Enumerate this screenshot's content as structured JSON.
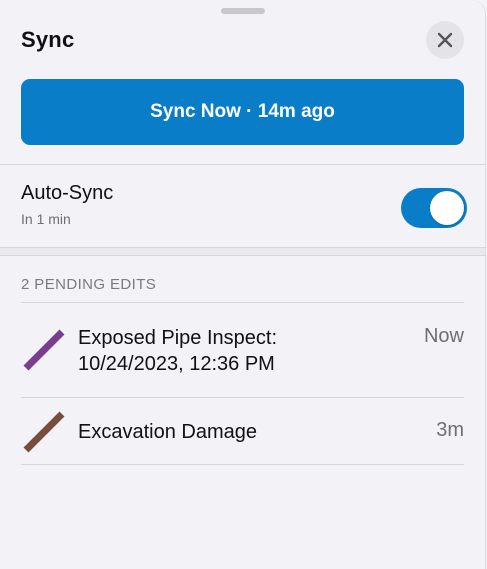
{
  "sheet": {
    "title": "Sync",
    "close_icon": "close-icon"
  },
  "sync_button": {
    "label": "Sync Now · 14m ago",
    "color": "#0a7dc9"
  },
  "auto_sync": {
    "label": "Auto-Sync",
    "subtitle": "In 1 min",
    "enabled": true
  },
  "pending": {
    "header": "2 PENDING EDITS",
    "items": [
      {
        "name_line1": "Exposed Pipe Inspect:",
        "name_line2": "10/24/2023, 12:36 PM",
        "time": "Now",
        "icon": "line-feature-icon",
        "color": "#7b3d8f"
      },
      {
        "name_line1": "Excavation Damage",
        "time": "3m",
        "icon": "line-feature-icon",
        "color": "#7a4e3e"
      }
    ]
  }
}
